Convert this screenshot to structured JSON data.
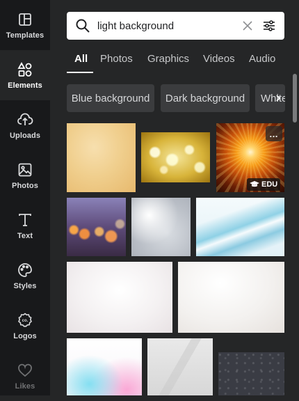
{
  "sidebar": {
    "items": [
      {
        "label": "Templates",
        "icon": "templates-icon"
      },
      {
        "label": "Elements",
        "icon": "elements-icon"
      },
      {
        "label": "Uploads",
        "icon": "uploads-icon"
      },
      {
        "label": "Photos",
        "icon": "photos-icon"
      },
      {
        "label": "Text",
        "icon": "text-icon"
      },
      {
        "label": "Styles",
        "icon": "styles-icon"
      },
      {
        "label": "Logos",
        "icon": "logos-icon"
      },
      {
        "label": "Likes",
        "icon": "heart-icon"
      }
    ],
    "active": "Elements"
  },
  "search": {
    "value": "light background",
    "icons": [
      "search-icon",
      "clear-icon",
      "filter-icon"
    ]
  },
  "tabs": {
    "items": [
      "All",
      "Photos",
      "Graphics",
      "Videos",
      "Audio"
    ],
    "active": "All"
  },
  "chips": {
    "items": [
      "Blue background",
      "Dark background",
      "White background"
    ],
    "next_icon": "chevron-right-icon"
  },
  "results": {
    "edu_badge": "EDU",
    "more_button": "…"
  },
  "colors": {
    "panel_bg": "#252627",
    "rail_bg": "#18191b",
    "chip_bg": "#3b3c3e",
    "active_text": "#ffffff"
  }
}
